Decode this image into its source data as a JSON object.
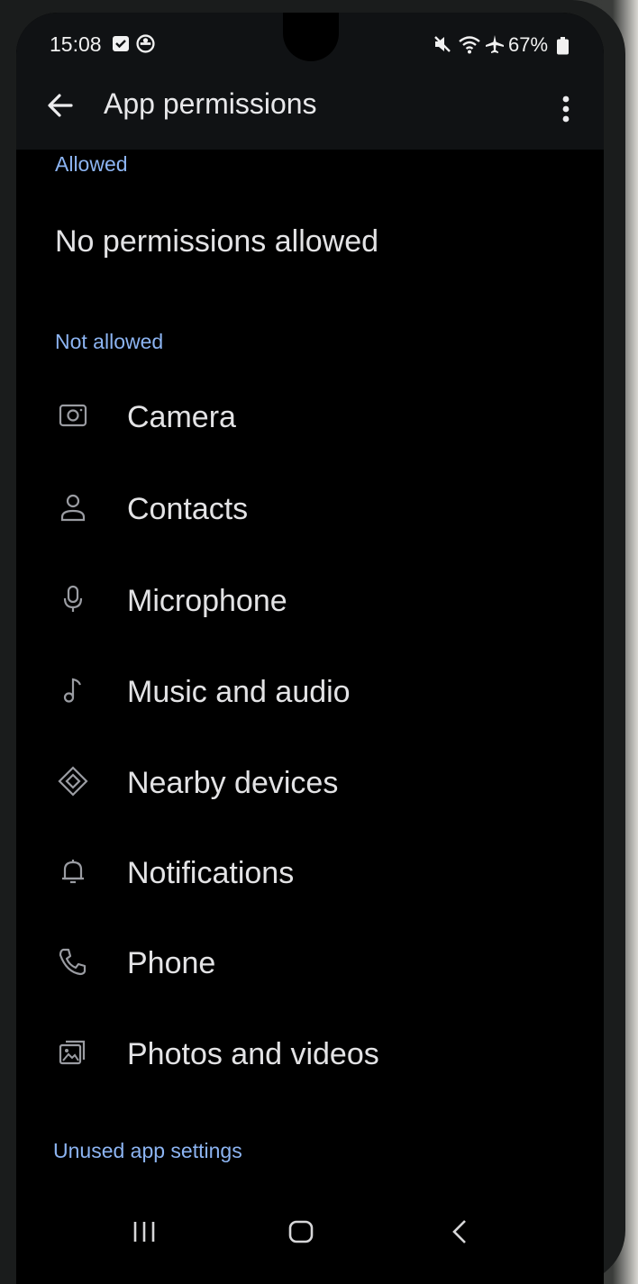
{
  "status_bar": {
    "time": "15:08",
    "battery": "67%",
    "icons": [
      "calendar-check-icon",
      "circle-app-icon",
      "mute-icon",
      "wifi-icon",
      "airplane-icon",
      "battery-icon"
    ]
  },
  "app_bar": {
    "title": "App permissions",
    "back_icon": "arrow-left-icon",
    "more_icon": "more-vert-icon"
  },
  "sections": {
    "allowed_header": "Allowed",
    "allowed_empty_text": "No permissions allowed",
    "not_allowed_header": "Not allowed",
    "unused_header": "Unused app settings"
  },
  "permissions": [
    {
      "label": "Camera",
      "icon": "camera-icon"
    },
    {
      "label": "Contacts",
      "icon": "person-icon"
    },
    {
      "label": "Microphone",
      "icon": "microphone-icon"
    },
    {
      "label": "Music and audio",
      "icon": "music-note-icon"
    },
    {
      "label": "Nearby devices",
      "icon": "nearby-devices-icon"
    },
    {
      "label": "Notifications",
      "icon": "bell-icon"
    },
    {
      "label": "Phone",
      "icon": "phone-icon"
    },
    {
      "label": "Photos and videos",
      "icon": "photos-icon"
    }
  ],
  "nav_bar": [
    "recents-icon",
    "home-icon",
    "back-icon"
  ],
  "colors": {
    "background": "#000000",
    "accent": "#8cb4f2",
    "text_primary": "#e3e3e5",
    "icon": "#9a9ca2"
  }
}
